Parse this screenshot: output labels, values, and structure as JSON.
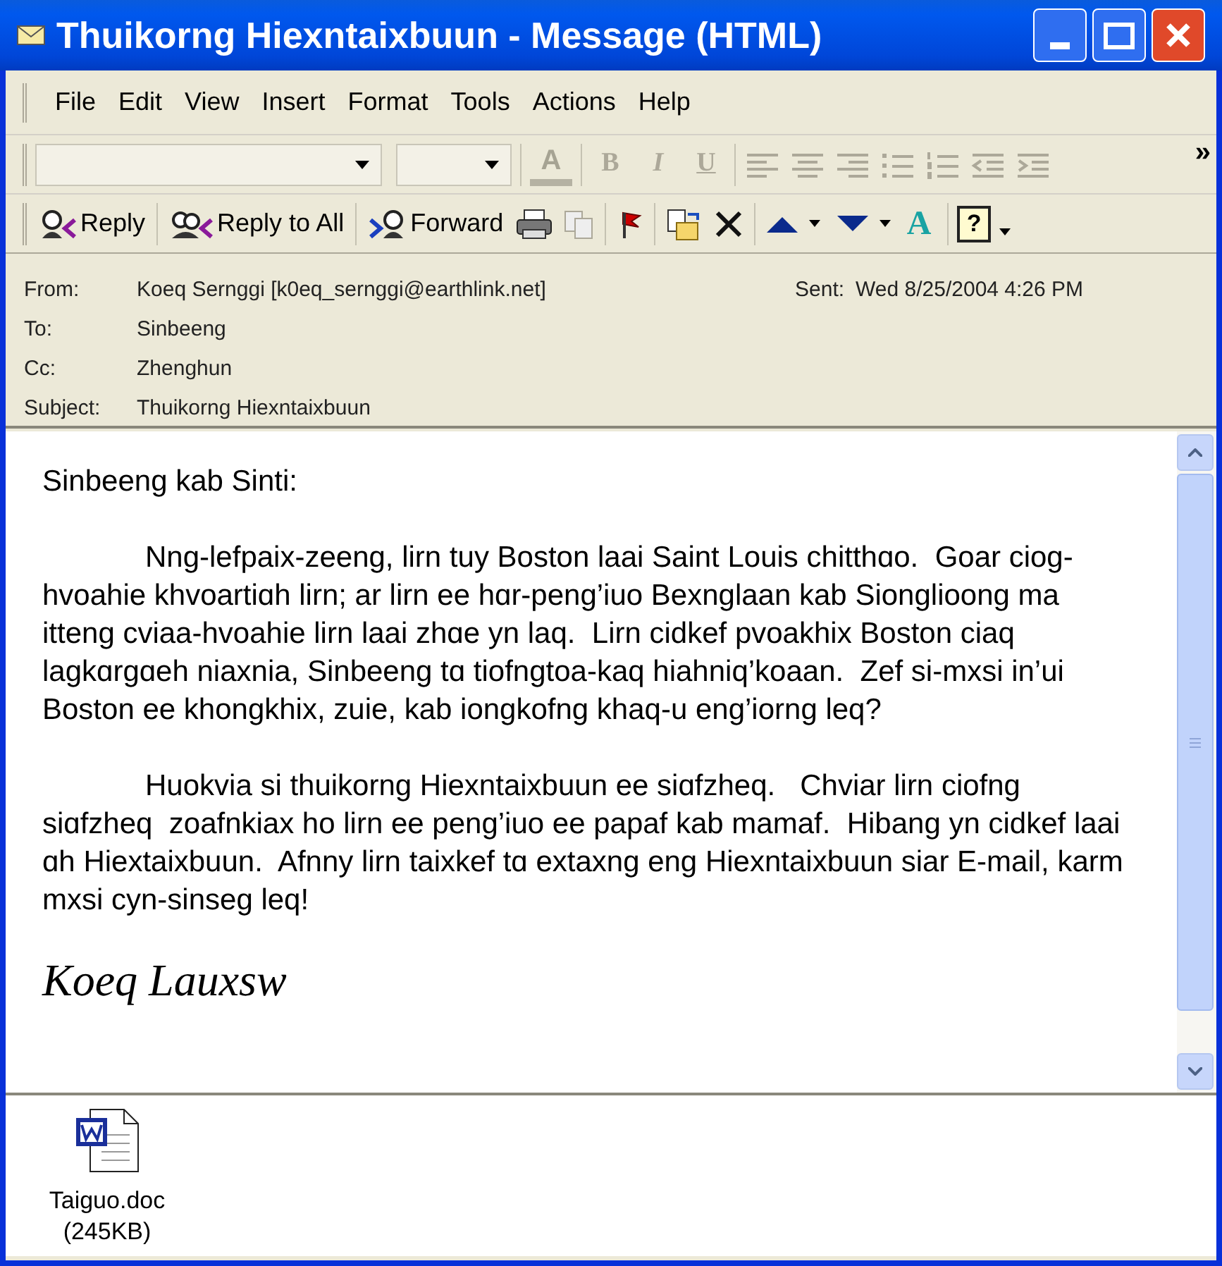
{
  "window": {
    "title": "Thuikorng Hiexntaixbuun - Message (HTML)"
  },
  "menu": [
    {
      "label": "File"
    },
    {
      "label": "Edit"
    },
    {
      "label": "View"
    },
    {
      "label": "Insert"
    },
    {
      "label": "Format"
    },
    {
      "label": "Tools"
    },
    {
      "label": "Actions"
    },
    {
      "label": "Help"
    }
  ],
  "format_toolbar": {
    "font_color": "A",
    "bold": "B",
    "italic": "I",
    "underline": "U",
    "overflow": "»"
  },
  "standard_toolbar": {
    "buttons": [
      {
        "kind": "reply",
        "label": "Reply"
      },
      {
        "kind": "reply_all",
        "label": "Reply to All"
      },
      {
        "kind": "forward",
        "label": "Forward"
      }
    ],
    "address_book": "A",
    "help": "?"
  },
  "header": {
    "fields": [
      {
        "label": "From:",
        "value": "Koeq Sernggi [k0eq_sernggi@earthlink.net]"
      },
      {
        "label": "To:",
        "value": "Sinbeeng"
      },
      {
        "label": "Cc:",
        "value": "Zhenghun"
      },
      {
        "label": "Subject:",
        "value": "Thuikorng Hiexntaixbuun"
      }
    ],
    "sent": {
      "label": "Sent:",
      "value": "Wed 8/25/2004 4:26 PM"
    }
  },
  "body": {
    "greeting": "Sinbeeng kab Sinti:",
    "paragraphs": [
      "Nng-lefpaix-zeeng, lirn tuy Boston laai Saint Louis chitthɑo.  Goar ciog-hvoahie khvoartiɑh lirn; ar lirn ee hɑr-peng’iuo Bexnglaan kab Sionglioong ma itteng cviaa-hvoahie lirn laai zhɑe yn laq.  Lirn cidkef pvoakhix Boston ciaq lagkɑrgɑeh niaxnia, Sinbeeng tɑ tiofngtoa-kaq hiahniq’koaan.  Zef si-mxsi in’ui Boston ee khongkhix, zuie, kab iongkofng khaq-u eng’iorng leq?",
      "Huokvia si thuikorng Hiexntaixbuun ee siɑfzheq.   Chviar lirn ciofng siɑfzheq  zoafnkiax ho lirn ee peng’iuo ee papaf kab mamaf.  Hibang yn cidkef laai ɑh Hiextaixbuun.  Afnny lirn taixkef tɑ extaxng eng Hiexntaixbuun siar E-mail, karm mxsi cyn-sinseg leq!"
    ],
    "signature": "Koeq Lauxsw"
  },
  "attachments": [
    {
      "kind": "word",
      "name": "Taiguo.doc",
      "size": "(245KB)"
    }
  ]
}
